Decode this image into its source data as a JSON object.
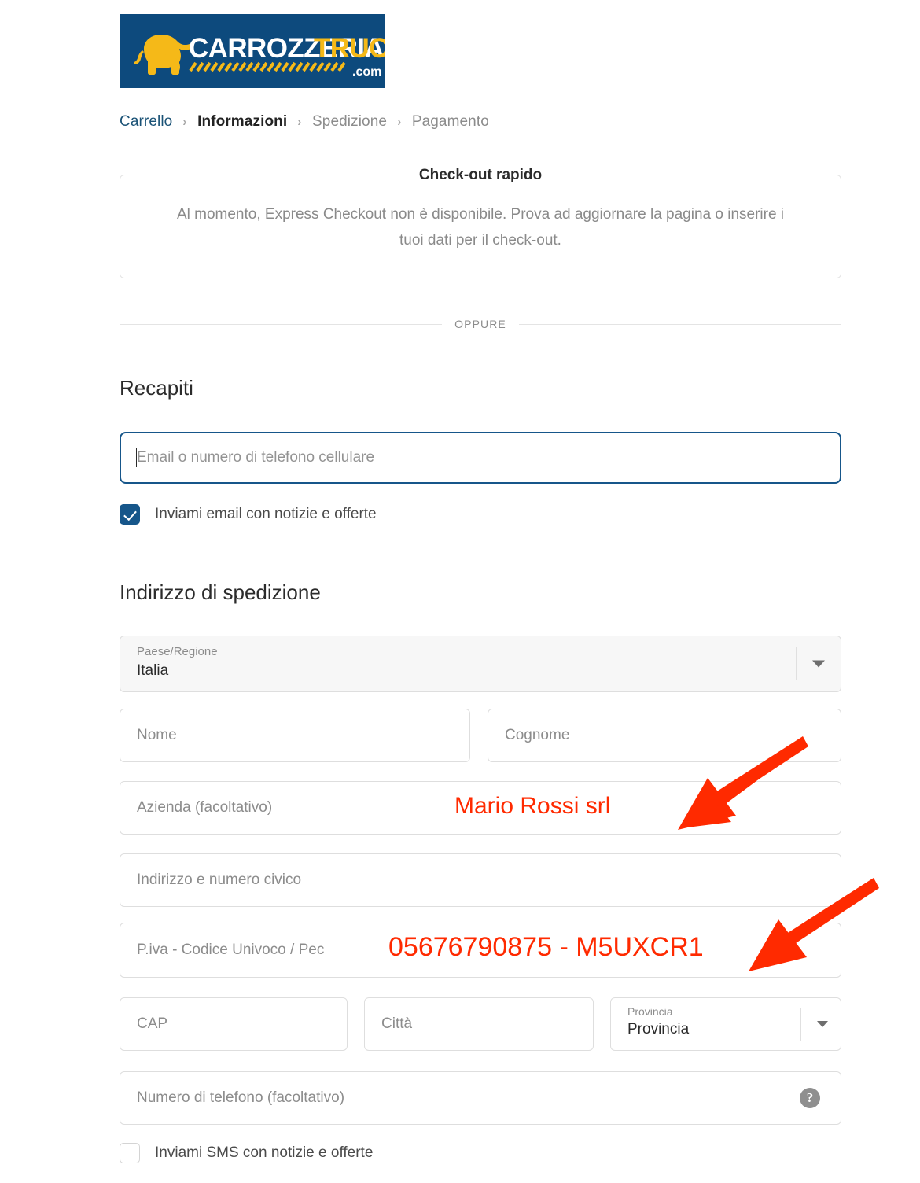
{
  "logo": {
    "brand_part1": "CARROZZERIA",
    "brand_part2": "TRUCK",
    "brand_tld": ".com",
    "bg_color": "#0d4a7d",
    "accent_color": "#f5b918",
    "icon": "elephant-icon"
  },
  "breadcrumb": {
    "items": [
      {
        "label": "Carrello",
        "state": "link"
      },
      {
        "label": "Informazioni",
        "state": "current"
      },
      {
        "label": "Spedizione",
        "state": "muted"
      },
      {
        "label": "Pagamento",
        "state": "muted"
      }
    ],
    "separator": "›"
  },
  "express_checkout": {
    "legend": "Check-out rapido",
    "message": "Al momento, Express Checkout non è disponibile. Prova ad aggiornare la pagina o inserire i tuoi dati per il check-out."
  },
  "divider": {
    "label": "OPPURE"
  },
  "contact": {
    "title": "Recapiti",
    "email_placeholder": "Email o numero di telefono cellulare",
    "email_value": "",
    "newsletter_label": "Inviami email con notizie e offerte",
    "newsletter_checked": "true"
  },
  "shipping": {
    "title": "Indirizzo di spedizione",
    "country": {
      "label": "Paese/Regione",
      "value": "Italia"
    },
    "first_name_placeholder": "Nome",
    "last_name_placeholder": "Cognome",
    "company_placeholder": "Azienda (facoltativo)",
    "address_placeholder": "Indirizzo e numero civico",
    "vat_placeholder": "P.iva - Codice Univoco / Pec",
    "zip_placeholder": "CAP",
    "city_placeholder": "Città",
    "province": {
      "label": "Provincia",
      "value": "Provincia"
    },
    "phone_placeholder": "Numero di telefono (facoltativo)",
    "phone_help_glyph": "?",
    "sms_label": "Inviami SMS con notizie e offerte",
    "sms_checked": "false"
  },
  "annotations": {
    "color": "#ff2a00",
    "company_example": "Mario Rossi srl",
    "vat_example": "05676790875 - M5UXCR1"
  }
}
